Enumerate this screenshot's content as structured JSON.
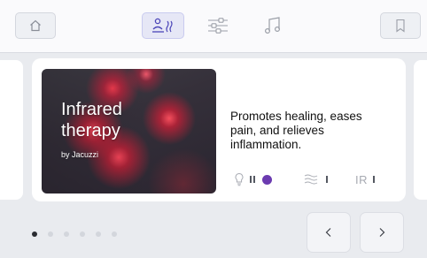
{
  "topbar": {
    "icons": [
      "home-icon",
      "sauna-icon",
      "sliders-icon",
      "music-note-icon",
      "bookmark-icon"
    ],
    "active": "sauna-icon"
  },
  "card": {
    "title_line1": "Infrared",
    "title_line2": "therapy",
    "subtitle": "by Jacuzzi",
    "description": "Promotes healing, eases pain, and relieves inflammation.",
    "levels": {
      "light": {
        "icon": "lightbulb-icon",
        "level_bars": 2,
        "active": true
      },
      "heat": {
        "icon": "heat-waves-icon",
        "level_bars": 1
      },
      "ir": {
        "label": "IR",
        "level_bars": 1
      }
    }
  },
  "pager": {
    "count": 6,
    "active_index": 0
  },
  "colors": {
    "accent": "#6b3bb0",
    "active_tab_bg": "#e6e7f6",
    "background": "#e9ebef"
  }
}
